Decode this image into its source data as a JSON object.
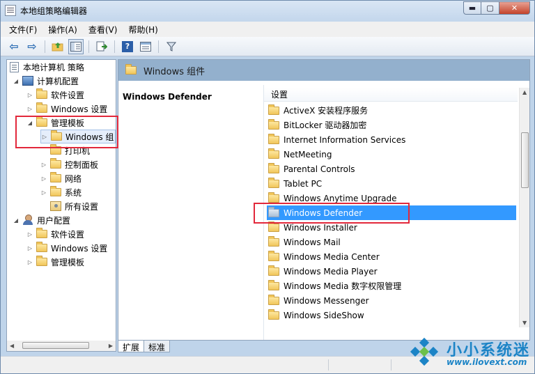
{
  "window": {
    "title": "本地组策略编辑器",
    "minimize_glyph": "▬",
    "maximize_glyph": "▢",
    "close_glyph": "✕"
  },
  "menu": {
    "items": [
      "文件(F)",
      "操作(A)",
      "查看(V)",
      "帮助(H)"
    ]
  },
  "toolbar": {
    "back_glyph": "⇦",
    "forward_glyph": "⇨",
    "help_glyph": "?",
    "filter_glyph": "⊽",
    "icons": [
      "back-arrow-icon",
      "forward-arrow-icon",
      "up-folder-icon",
      "show-hide-tree-icon",
      "export-list-icon",
      "help-icon",
      "properties-icon",
      "filter-icon"
    ]
  },
  "tree": {
    "root": "本地计算机 策略",
    "computer_config": "计算机配置",
    "cc_software": "软件设置",
    "cc_windows": "Windows 设置",
    "cc_admin": "管理模板",
    "cc_admin_windows": "Windows 组",
    "cc_admin_printer": "打印机",
    "cc_admin_control": "控制面板",
    "cc_admin_network": "网络",
    "cc_admin_system": "系统",
    "cc_admin_all": "所有设置",
    "user_config": "用户配置",
    "uc_software": "软件设置",
    "uc_windows": "Windows 设置",
    "uc_admin": "管理模板",
    "collapse_glyph": "◢",
    "expand_glyph": "▷"
  },
  "right": {
    "header": "Windows 组件",
    "description_title": "Windows Defender",
    "column_header": "设置",
    "items": [
      "ActiveX 安装程序服务",
      "BitLocker 驱动器加密",
      "Internet Information Services",
      "NetMeeting",
      "Parental Controls",
      "Tablet PC",
      "Windows Anytime Upgrade",
      "Windows Defender",
      "Windows Installer",
      "Windows Mail",
      "Windows Media Center",
      "Windows Media Player",
      "Windows Media 数字权限管理",
      "Windows Messenger",
      "Windows SideShow"
    ],
    "selected_item": "Windows Defender"
  },
  "tabs": {
    "extended": "扩展",
    "standard": "标准"
  },
  "scroll": {
    "up_glyph": "▲",
    "down_glyph": "▼",
    "left_glyph": "◀",
    "right_glyph": "▶"
  },
  "watermark": {
    "name": "小小系统迷",
    "url": "www.ilovext.com"
  },
  "colors": {
    "selection": "#3399ff",
    "highlight_box": "#e2283b",
    "header_band": "#93b0cd",
    "watermark": "#1c84c6"
  }
}
